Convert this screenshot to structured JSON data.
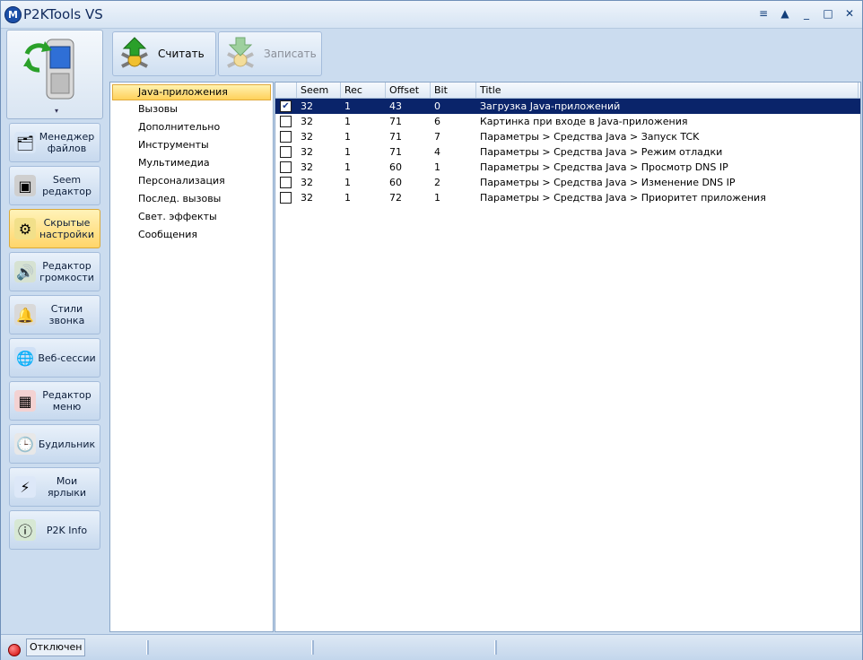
{
  "window": {
    "title": "P2KTools VS"
  },
  "titlebar_buttons": [
    "≡",
    "▲",
    "_",
    "□",
    "✕"
  ],
  "nav": {
    "items": [
      {
        "label": "Менеджер\nфайлов",
        "icon": "file-manager-icon",
        "active": false
      },
      {
        "label": "Seem\nредактор",
        "icon": "seem-editor-icon",
        "active": false
      },
      {
        "label": "Скрытые\nнастройки",
        "icon": "gear-icon",
        "active": true
      },
      {
        "label": "Редактор\nгромкости",
        "icon": "speaker-icon",
        "active": false
      },
      {
        "label": "Стили звонка",
        "icon": "ringtone-icon",
        "active": false
      },
      {
        "label": "Веб-сессии",
        "icon": "globe-icon",
        "active": false
      },
      {
        "label": "Редактор\nменю",
        "icon": "menu-editor-icon",
        "active": false
      },
      {
        "label": "Будильник",
        "icon": "clock-icon",
        "active": false
      },
      {
        "label": "Мои ярлыки",
        "icon": "shortcuts-icon",
        "active": false
      },
      {
        "label": "P2K Info",
        "icon": "info-icon",
        "active": false
      }
    ]
  },
  "toolbar": {
    "read_label": "Считать",
    "write_label": "Записать"
  },
  "categories": [
    "Java-приложения",
    "Вызовы",
    "Дополнительно",
    "Инструменты",
    "Мультимедиа",
    "Персонализация",
    "Послед. вызовы",
    "Свет. эффекты",
    "Сообщения"
  ],
  "table": {
    "columns": [
      "",
      "Seem",
      "Rec",
      "Offset",
      "Bit",
      "Title"
    ],
    "rows": [
      {
        "checked": true,
        "seem": "32",
        "rec": "1",
        "offset": "43",
        "bit": "0",
        "title": "Загрузка Java-приложений",
        "selected": true
      },
      {
        "checked": false,
        "seem": "32",
        "rec": "1",
        "offset": "71",
        "bit": "6",
        "title": "Картинка при входе в Java-приложения",
        "selected": false
      },
      {
        "checked": false,
        "seem": "32",
        "rec": "1",
        "offset": "71",
        "bit": "7",
        "title": "Параметры > Средства Java > Запуск TCK",
        "selected": false
      },
      {
        "checked": false,
        "seem": "32",
        "rec": "1",
        "offset": "71",
        "bit": "4",
        "title": "Параметры > Средства Java > Режим отладки",
        "selected": false
      },
      {
        "checked": false,
        "seem": "32",
        "rec": "1",
        "offset": "60",
        "bit": "1",
        "title": "Параметры > Средства Java > Просмотр DNS IP",
        "selected": false
      },
      {
        "checked": false,
        "seem": "32",
        "rec": "1",
        "offset": "60",
        "bit": "2",
        "title": "Параметры > Средства Java > Изменение DNS IP",
        "selected": false
      },
      {
        "checked": false,
        "seem": "32",
        "rec": "1",
        "offset": "72",
        "bit": "1",
        "title": "Параметры > Средства Java > Приоритет приложения",
        "selected": false
      }
    ]
  },
  "status": {
    "text": "Отключен",
    "led_color": "#d00000"
  }
}
